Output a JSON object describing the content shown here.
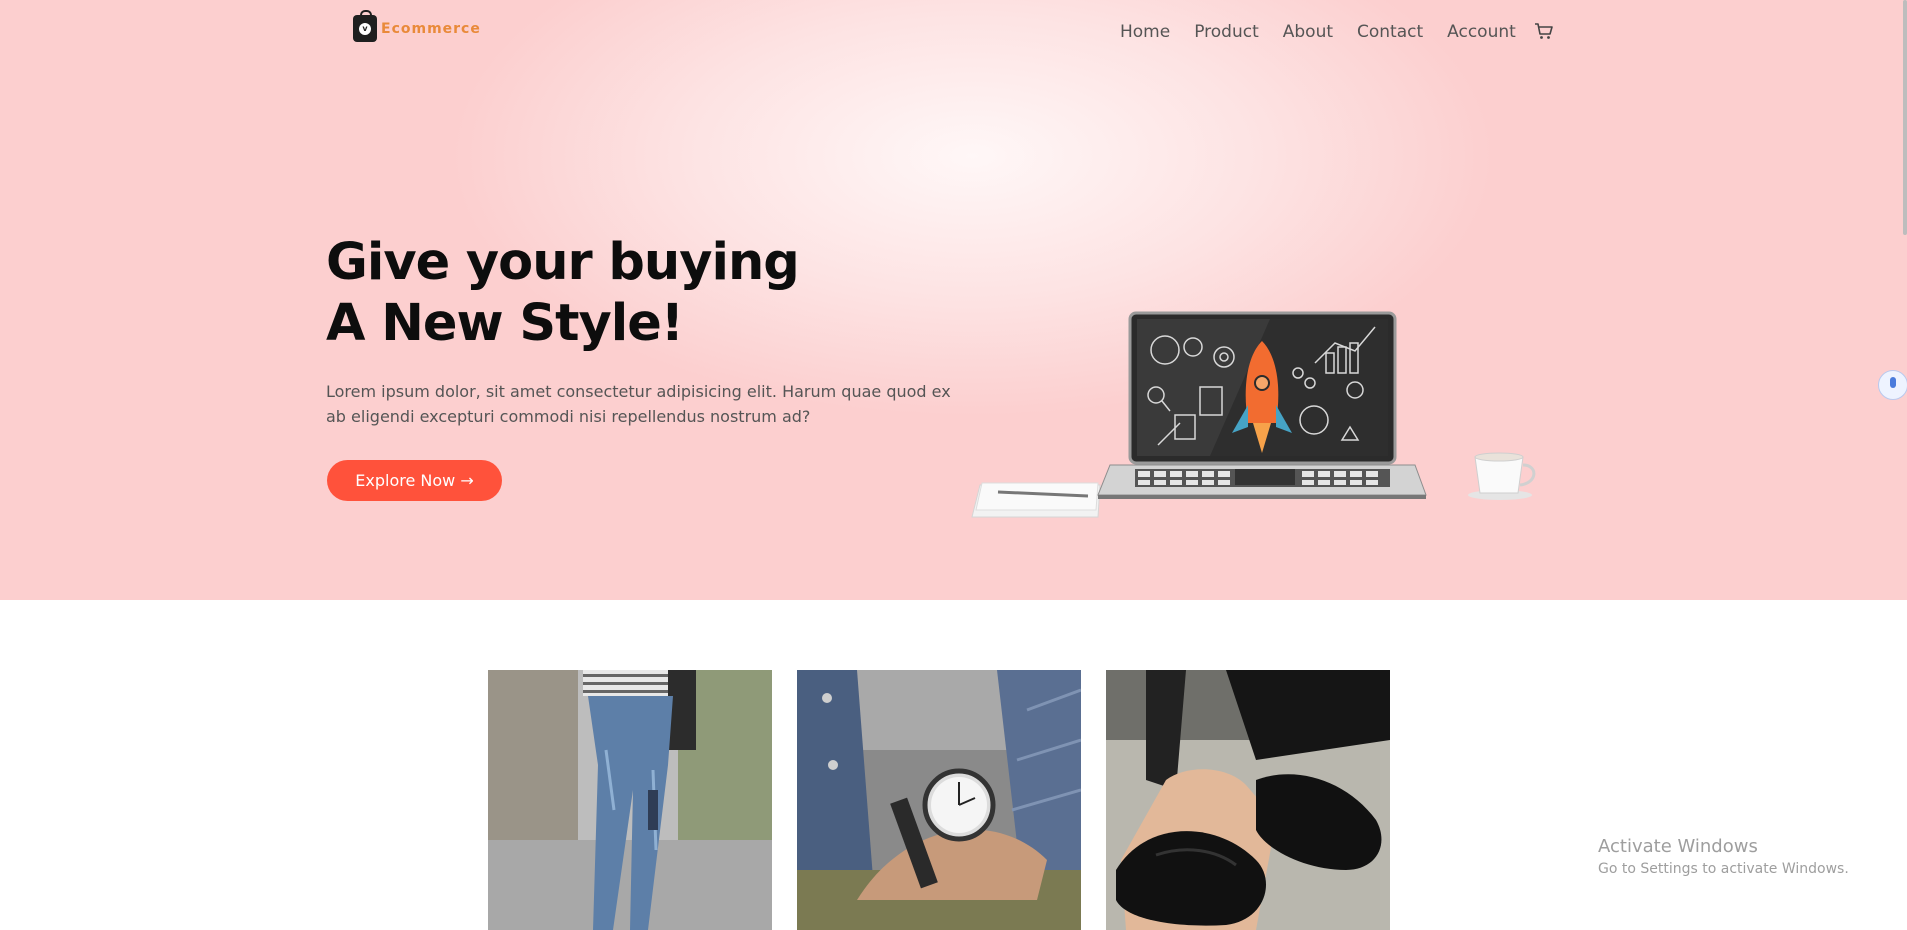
{
  "brand": {
    "name": "Ecommerce",
    "badge": "v",
    "accent": "#e98a3a"
  },
  "nav": {
    "items": [
      "Home",
      "Product",
      "About",
      "Contact",
      "Account"
    ],
    "cart_icon": "cart-icon"
  },
  "hero": {
    "title_line1": "Give your buying",
    "title_line2": "A New Style!",
    "description": "Lorem ipsum dolor, sit amet consectetur adipisicing elit. Harum quae quod ex ab eligendi excepturi commodi nisi repellendus nostrum ad?",
    "cta_label": "Explore Now →",
    "cta_color": "#ff523b"
  },
  "products": [
    {
      "name": "jeans-image"
    },
    {
      "name": "watch-image"
    },
    {
      "name": "loafers-image"
    }
  ],
  "os_watermark": {
    "title": "Activate Windows",
    "subtitle": "Go to Settings to activate Windows."
  }
}
